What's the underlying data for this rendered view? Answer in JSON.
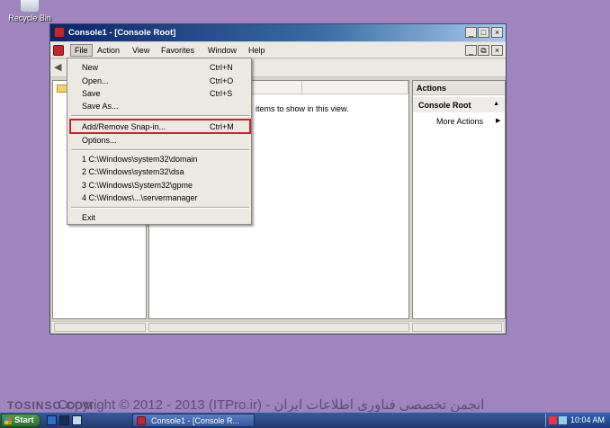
{
  "desktop": {
    "recycle_bin_label": "Recycle Bin"
  },
  "window": {
    "title": "Console1 - [Console Root]",
    "controls": {
      "minimize": "_",
      "restore": "□",
      "close": "×"
    },
    "inner_controls": {
      "minimize": "_",
      "restore": "⧉",
      "close": "×"
    }
  },
  "menubar": {
    "items": [
      "File",
      "Action",
      "View",
      "Favorites",
      "Window",
      "Help"
    ],
    "active": "File"
  },
  "file_menu": {
    "items": [
      {
        "label": "New",
        "shortcut": "Ctrl+N"
      },
      {
        "label": "Open...",
        "shortcut": "Ctrl+O"
      },
      {
        "label": "Save",
        "shortcut": "Ctrl+S"
      },
      {
        "label": "Save As...",
        "shortcut": ""
      },
      {
        "label": "Add/Remove Snap-in...",
        "shortcut": "Ctrl+M"
      },
      {
        "label": "Options...",
        "shortcut": ""
      },
      {
        "label": "1 C:\\Windows\\system32\\domain",
        "shortcut": ""
      },
      {
        "label": "2 C:\\Windows\\system32\\dsa",
        "shortcut": ""
      },
      {
        "label": "3 C:\\Windows\\System32\\gpme",
        "shortcut": ""
      },
      {
        "label": "4 C:\\Windows\\...\\servermanager",
        "shortcut": ""
      },
      {
        "label": "Exit",
        "shortcut": ""
      }
    ],
    "highlighted": "Add/Remove Snap-in..."
  },
  "list_pane": {
    "empty_message": "items to show in this view."
  },
  "actions_pane": {
    "header": "Actions",
    "section": "Console Root",
    "more_actions": "More Actions"
  },
  "watermark": {
    "left": "TOSINSO.COM",
    "main": "Copyright © 2012 - 2013 (ITPro.ir) - انجمن تخصصی فناوری اطلاعات ایران"
  },
  "taskbar": {
    "start_label": "Start",
    "task_button": "Console1 - [Console R...",
    "clock": "10:04 AM"
  },
  "colors": {
    "desktop": "#9f84bd",
    "highlight_border": "#d0202e",
    "title_gradient_start": "#0a246a"
  }
}
